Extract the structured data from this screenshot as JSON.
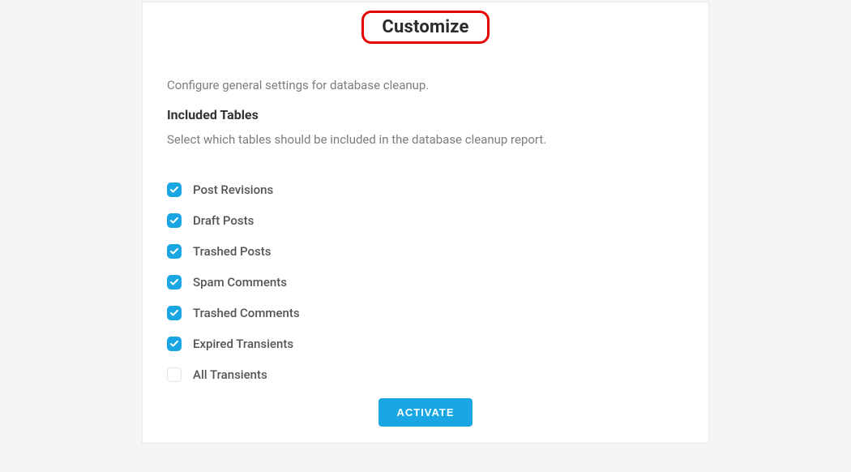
{
  "header": {
    "title": "Customize"
  },
  "body": {
    "description": "Configure general settings for database cleanup.",
    "section_title": "Included Tables",
    "section_sub": "Select which tables should be included in the database cleanup report."
  },
  "checks": {
    "items": [
      {
        "label": "Post Revisions",
        "checked": true
      },
      {
        "label": "Draft Posts",
        "checked": true
      },
      {
        "label": "Trashed Posts",
        "checked": true
      },
      {
        "label": "Spam Comments",
        "checked": true
      },
      {
        "label": "Trashed Comments",
        "checked": true
      },
      {
        "label": "Expired Transients",
        "checked": true
      },
      {
        "label": "All Transients",
        "checked": false
      }
    ]
  },
  "footer": {
    "activate_label": "ACTIVATE"
  },
  "colors": {
    "accent": "#19a6e3",
    "highlight_border": "#e60000"
  }
}
